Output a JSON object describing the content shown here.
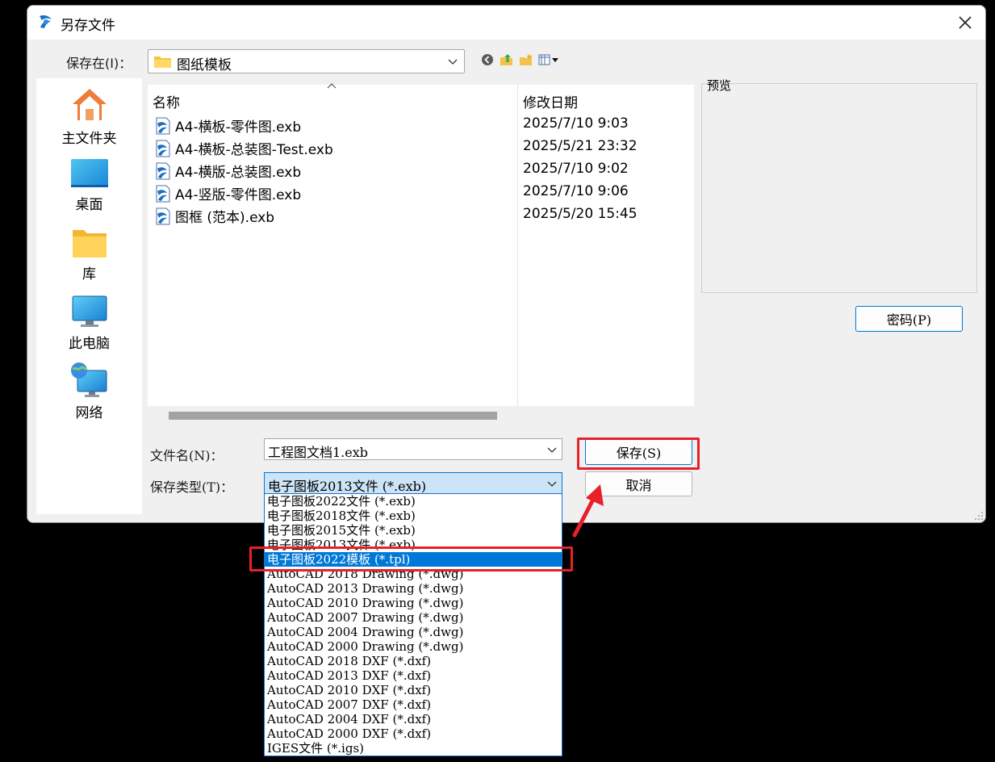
{
  "window": {
    "title": "另存文件"
  },
  "location": {
    "label": "保存在(I)：",
    "value": "图纸模板"
  },
  "places": [
    {
      "label": "主文件夹",
      "icon": "home-icon"
    },
    {
      "label": "桌面",
      "icon": "desktop-icon"
    },
    {
      "label": "库",
      "icon": "library-folder-icon"
    },
    {
      "label": "此电脑",
      "icon": "computer-icon"
    },
    {
      "label": "网络",
      "icon": "network-icon"
    }
  ],
  "file_list": {
    "col_name": "名称",
    "col_date": "修改日期",
    "rows": [
      {
        "name": "A4-横板-零件图.exb",
        "date": "2025/7/10 9:03"
      },
      {
        "name": "A4-横板-总装图-Test.exb",
        "date": "2025/5/21 23:32"
      },
      {
        "name": "A4-横版-总装图.exb",
        "date": "2025/7/10 9:02"
      },
      {
        "name": "A4-竖版-零件图.exb",
        "date": "2025/7/10 9:06"
      },
      {
        "name": "图框 (范本).exb",
        "date": "2025/5/20 15:45"
      }
    ]
  },
  "preview": {
    "label": "预览"
  },
  "password_button": "密码(P)",
  "filename": {
    "label": "文件名(N)：",
    "value": "工程图文档1.exb"
  },
  "filetype": {
    "label": "保存类型(T)：",
    "value": "电子图板2013文件 (*.exb)",
    "options": [
      "电子图板2022文件 (*.exb)",
      "电子图板2018文件 (*.exb)",
      "电子图板2015文件 (*.exb)",
      "电子图板2013文件 (*.exb)",
      "电子图板2022模板 (*.tpl)",
      "AutoCAD 2018 Drawing (*.dwg)",
      "AutoCAD 2013 Drawing (*.dwg)",
      "AutoCAD 2010 Drawing (*.dwg)",
      "AutoCAD 2007 Drawing (*.dwg)",
      "AutoCAD 2004 Drawing (*.dwg)",
      "AutoCAD 2000 Drawing (*.dwg)",
      "AutoCAD 2018 DXF (*.dxf)",
      "AutoCAD 2013 DXF (*.dxf)",
      "AutoCAD 2010 DXF (*.dxf)",
      "AutoCAD 2007 DXF (*.dxf)",
      "AutoCAD 2004 DXF (*.dxf)",
      "AutoCAD 2000 DXF (*.dxf)",
      "IGES文件 (*.igs)"
    ],
    "highlighted_index": 4
  },
  "buttons": {
    "save": "保存(S)",
    "cancel": "取消"
  },
  "colors": {
    "accent": "#0078d7",
    "annotation_red": "#e8202a"
  }
}
